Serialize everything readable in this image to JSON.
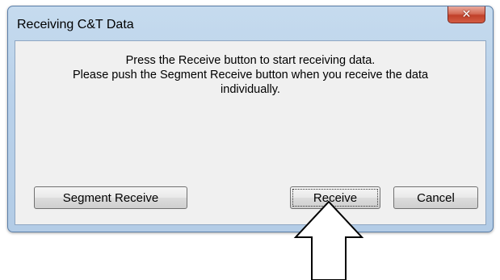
{
  "window": {
    "title": "Receiving C&T Data",
    "close_icon": "x-icon"
  },
  "message": {
    "lines": [
      "Press the Receive button to start receiving data.",
      "Please push the Segment Receive button when you receive the data",
      "individually."
    ]
  },
  "buttons": {
    "segment_receive": "Segment Receive",
    "receive": "Receive",
    "cancel": "Cancel"
  },
  "annotation": {
    "icon": "up-arrow-icon",
    "target": "Receive"
  }
}
